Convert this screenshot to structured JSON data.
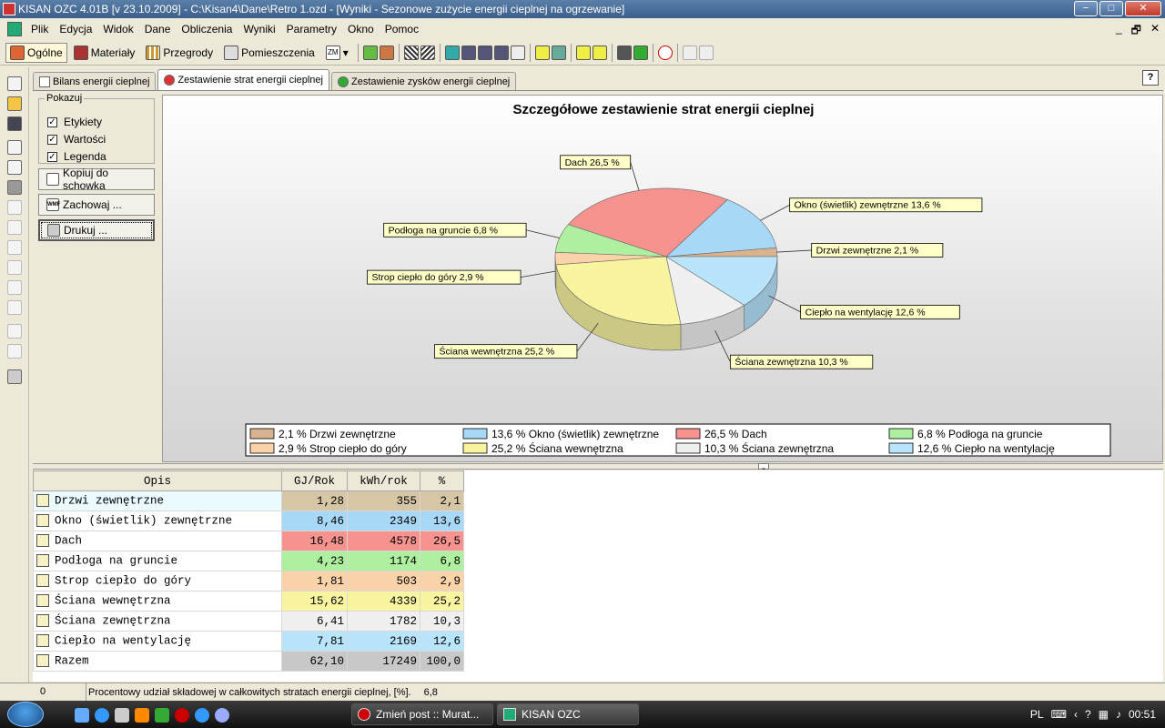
{
  "window": {
    "title": "KISAN OZC 4.01B [v 23.10.2009] - C:\\Kisan4\\Dane\\Retro 1.ozd - [Wyniki - Sezonowe zużycie energii cieplnej na ogrzewanie]",
    "buttons": [
      "−",
      "□",
      "✕"
    ]
  },
  "menu": {
    "items": [
      "Plik",
      "Edycja",
      "Widok",
      "Dane",
      "Obliczenia",
      "Wyniki",
      "Parametry",
      "Okno",
      "Pomoc"
    ],
    "mdi_buttons": [
      "_",
      "🗗",
      "✕"
    ]
  },
  "toolbar": {
    "ogolne": "Ogólne",
    "materialy": "Materiały",
    "przegrody": "Przegrody",
    "pomieszczenia": "Pomieszczenia",
    "zm_label": "ZM"
  },
  "tabs": [
    {
      "label": "Bilans energii cieplnej"
    },
    {
      "label": "Zestawienie strat energii cieplnej"
    },
    {
      "label": "Zestawienie zysków energii cieplnej"
    }
  ],
  "help_label": "?",
  "side": {
    "group_title": "Pokazuj",
    "checkboxes": [
      {
        "label": "Etykiety",
        "checked": true
      },
      {
        "label": "Wartości",
        "checked": true
      },
      {
        "label": "Legenda",
        "checked": true
      }
    ],
    "copy_button": "Kopiuj do schowka",
    "save_button": "Zachowaj ...",
    "print_button": "Drukuj ...",
    "wmf_label": "WMF"
  },
  "chart_data": {
    "type": "pie",
    "title": "Szczegółowe zestawienie strat energii cieplnej",
    "legend_position": "bottom",
    "slices": [
      {
        "name": "Drzwi zewnętrzne",
        "value": 2.1,
        "label": "Drzwi zewnętrzne 2,1 %",
        "legend": "2,1 % Drzwi zewnętrzne",
        "color": "#d7b48f"
      },
      {
        "name": "Okno (świetlik) zewnętrzne",
        "value": 13.6,
        "label": "Okno (świetlik) zewnętrzne 13,6 %",
        "legend": "13,6 % Okno (świetlik) zewnętrzne",
        "color": "#a8d8f8"
      },
      {
        "name": "Dach",
        "value": 26.5,
        "label": "Dach 26,5 %",
        "legend": "26,5 % Dach",
        "color": "#f7938f"
      },
      {
        "name": "Podłoga na gruncie",
        "value": 6.8,
        "label": "Podłoga na gruncie 6,8 %",
        "legend": "6,8 % Podłoga na gruncie",
        "color": "#aef0a0"
      },
      {
        "name": "Strop ciepło do góry",
        "value": 2.9,
        "label": "Strop ciepło do góry 2,9 %",
        "legend": "2,9 % Strop ciepło do góry",
        "color": "#fbd3a8"
      },
      {
        "name": "Ściana wewnętrzna",
        "value": 25.2,
        "label": "Ściana wewnętrzna 25,2 %",
        "legend": "25,2 % Ściana wewnętrzna",
        "color": "#f8f4a0"
      },
      {
        "name": "Ściana zewnętrzna",
        "value": 10.3,
        "label": "Ściana zewnętrzna 10,3 %",
        "legend": "10,3 % Ściana zewnętrzna",
        "color": "#f0f0f0"
      },
      {
        "name": "Ciepło na wentylację",
        "value": 12.6,
        "label": "Ciepło na wentylację 12,6 %",
        "legend": "12,6 % Ciepło na wentylację",
        "color": "#b8e4fc"
      }
    ]
  },
  "table": {
    "headers": [
      "Opis",
      "GJ/Rok",
      "kWh/rok",
      "%"
    ],
    "rows": [
      {
        "opis": "Drzwi zewnętrzne",
        "gj": "1,28",
        "kwh": "355",
        "pct": "2,1",
        "color": "#d7c6a5"
      },
      {
        "opis": "Okno (świetlik) zewnętrzne",
        "gj": "8,46",
        "kwh": "2349",
        "pct": "13,6",
        "color": "#a8d8f8"
      },
      {
        "opis": "Dach",
        "gj": "16,48",
        "kwh": "4578",
        "pct": "26,5",
        "color": "#f7938f"
      },
      {
        "opis": "Podłoga na gruncie",
        "gj": "4,23",
        "kwh": "1174",
        "pct": "6,8",
        "color": "#aef0a0"
      },
      {
        "opis": "Strop ciepło do góry",
        "gj": "1,81",
        "kwh": "503",
        "pct": "2,9",
        "color": "#fbd3a8"
      },
      {
        "opis": "Ściana wewnętrzna",
        "gj": "15,62",
        "kwh": "4339",
        "pct": "25,2",
        "color": "#f8f4a0"
      },
      {
        "opis": "Ściana zewnętrzna",
        "gj": "6,41",
        "kwh": "1782",
        "pct": "10,3",
        "color": "#f0f0f0"
      },
      {
        "opis": "Ciepło na wentylację",
        "gj": "7,81",
        "kwh": "2169",
        "pct": "12,6",
        "color": "#b8e4fc"
      },
      {
        "opis": "Razem",
        "gj": "62,10",
        "kwh": "17249",
        "pct": "100,0",
        "color": "#c8c8c8"
      }
    ]
  },
  "status": {
    "cell1": "0",
    "text": "Procentowy udział składowej w całkowitych stratach energii cieplnej, [%].",
    "value": "6,8"
  },
  "taskbar": {
    "tasks": [
      "Zmień post :: Murat...",
      "KISAN OZC"
    ],
    "lang": "PL",
    "clock": "00:51"
  }
}
